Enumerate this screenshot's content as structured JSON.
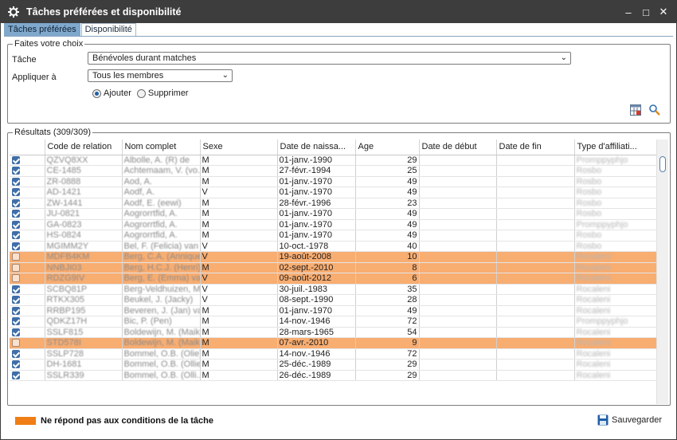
{
  "window": {
    "title": "Tâches préférées et disponibilité"
  },
  "tabs": [
    {
      "label": "Tâches préférées"
    },
    {
      "label": "Disponibilité"
    }
  ],
  "choice": {
    "legend": "Faites votre choix",
    "task_label": "Tâche",
    "task_value": "Bénévoles durant matches",
    "apply_label": "Appliquer à",
    "apply_value": "Tous les membres",
    "radio_add": "Ajouter",
    "radio_remove": "Supprimer",
    "selected_radio": "Ajouter"
  },
  "results": {
    "legend": "Résultats (309/309)",
    "columns": [
      "Code de relation",
      "Nom complet",
      "Sexe",
      "Date de naissa...",
      "Age",
      "Date de début",
      "Date de fin",
      "Type d'affiliati..."
    ],
    "rows": [
      {
        "code": "QZVQ8XX",
        "name": "Albolle, A. (R) de",
        "sex": "M",
        "dob": "01-janv.-1990",
        "age": "29",
        "aff": "Promppyphjo",
        "checked": true,
        "alert": false
      },
      {
        "code": "CE-1485",
        "name": "Achtemaam, V. (vo...",
        "sex": "M",
        "dob": "27-févr.-1994",
        "age": "25",
        "aff": "Rosbo",
        "checked": true,
        "alert": false
      },
      {
        "code": "ZR-0888",
        "name": "Aod, A.",
        "sex": "M",
        "dob": "01-janv.-1970",
        "age": "49",
        "aff": "Rosbo",
        "checked": true,
        "alert": false
      },
      {
        "code": "AD-1421",
        "name": "Aodf, A.",
        "sex": "V",
        "dob": "01-janv.-1970",
        "age": "49",
        "aff": "Rosbo",
        "checked": true,
        "alert": false
      },
      {
        "code": "ZW-1441",
        "name": "Aodf, E. (eewi)",
        "sex": "M",
        "dob": "28-févr.-1996",
        "age": "23",
        "aff": "Rosbo",
        "checked": true,
        "alert": false
      },
      {
        "code": "JU-0821",
        "name": "Aogrorrtfid, A.",
        "sex": "M",
        "dob": "01-janv.-1970",
        "age": "49",
        "aff": "Rosbo",
        "checked": true,
        "alert": false
      },
      {
        "code": "GA-0823",
        "name": "Aogrorrtfid, A.",
        "sex": "M",
        "dob": "01-janv.-1970",
        "age": "49",
        "aff": "Promppyphjo",
        "checked": true,
        "alert": false
      },
      {
        "code": "HS-0824",
        "name": "Aogrorrtfid, A.",
        "sex": "M",
        "dob": "01-janv.-1970",
        "age": "49",
        "aff": "Rosbo",
        "checked": true,
        "alert": false
      },
      {
        "code": "MGIMM2Y",
        "name": "Bel, F. (Felicia) van",
        "sex": "V",
        "dob": "10-oct.-1978",
        "age": "40",
        "aff": "Rosbo",
        "checked": true,
        "alert": false
      },
      {
        "code": "MDFB4KM",
        "name": "Berg, C.A. (Annique...",
        "sex": "V",
        "dob": "19-août-2008",
        "age": "10",
        "aff": "Rocaleni",
        "checked": false,
        "alert": true
      },
      {
        "code": "NNBJI03",
        "name": "Berg, H.C.J. (Henri) ...",
        "sex": "M",
        "dob": "02-sept.-2010",
        "age": "8",
        "aff": "Rocaleni",
        "checked": false,
        "alert": true
      },
      {
        "code": "RDZG9IV",
        "name": "Berg, E. (Emma) van...",
        "sex": "V",
        "dob": "09-août-2012",
        "age": "6",
        "aff": "Rocaleni",
        "checked": false,
        "alert": true
      },
      {
        "code": "SCBQ81P",
        "name": "Berg-Veldhuizen, M...",
        "sex": "V",
        "dob": "30-juil.-1983",
        "age": "35",
        "aff": "Rocaleni",
        "checked": true,
        "alert": false
      },
      {
        "code": "RTKX305",
        "name": "Beukel, J. (Jacky)",
        "sex": "V",
        "dob": "08-sept.-1990",
        "age": "28",
        "aff": "Rocaleni",
        "checked": true,
        "alert": false
      },
      {
        "code": "RRBP195",
        "name": "Beveren, J. (Jan) van",
        "sex": "M",
        "dob": "01-janv.-1970",
        "age": "49",
        "aff": "Rocaleni",
        "checked": true,
        "alert": false
      },
      {
        "code": "QDKZ17H",
        "name": "Bic, P. (Pen)",
        "sex": "M",
        "dob": "14-nov.-1946",
        "age": "72",
        "aff": "Promppyphjo",
        "checked": true,
        "alert": false
      },
      {
        "code": "SSLF815",
        "name": "Boldewijn, M. (Maik...",
        "sex": "M",
        "dob": "28-mars-1965",
        "age": "54",
        "aff": "Rocaleni",
        "checked": true,
        "alert": false
      },
      {
        "code": "STD578I",
        "name": "Boldewijn, M. (Maik...",
        "sex": "M",
        "dob": "07-avr.-2010",
        "age": "9",
        "aff": "Rocaleni",
        "checked": false,
        "alert": true
      },
      {
        "code": "SSLP728",
        "name": "Bommel, O.B. (Olie)",
        "sex": "M",
        "dob": "14-nov.-1946",
        "age": "72",
        "aff": "Rocaleni",
        "checked": true,
        "alert": false
      },
      {
        "code": "DH-1681",
        "name": "Bommel, O.B. (Ollie...",
        "sex": "M",
        "dob": "25-déc.-1989",
        "age": "29",
        "aff": "Rocaleni",
        "checked": true,
        "alert": false
      },
      {
        "code": "SSLR339",
        "name": "Bommel, O.B. (Olli...",
        "sex": "M",
        "dob": "26-déc.-1989",
        "age": "29",
        "aff": "Rocaleni",
        "checked": true,
        "alert": false
      }
    ]
  },
  "footer": {
    "legend_text": "Ne répond pas aux conditions de la tâche",
    "save_label": "Sauvegarder"
  },
  "colors": {
    "alert_row": "#f8ad71",
    "legend_swatch": "#f07d15",
    "titlebar": "#3d3d3d",
    "active_tab": "#7fa8cc"
  }
}
